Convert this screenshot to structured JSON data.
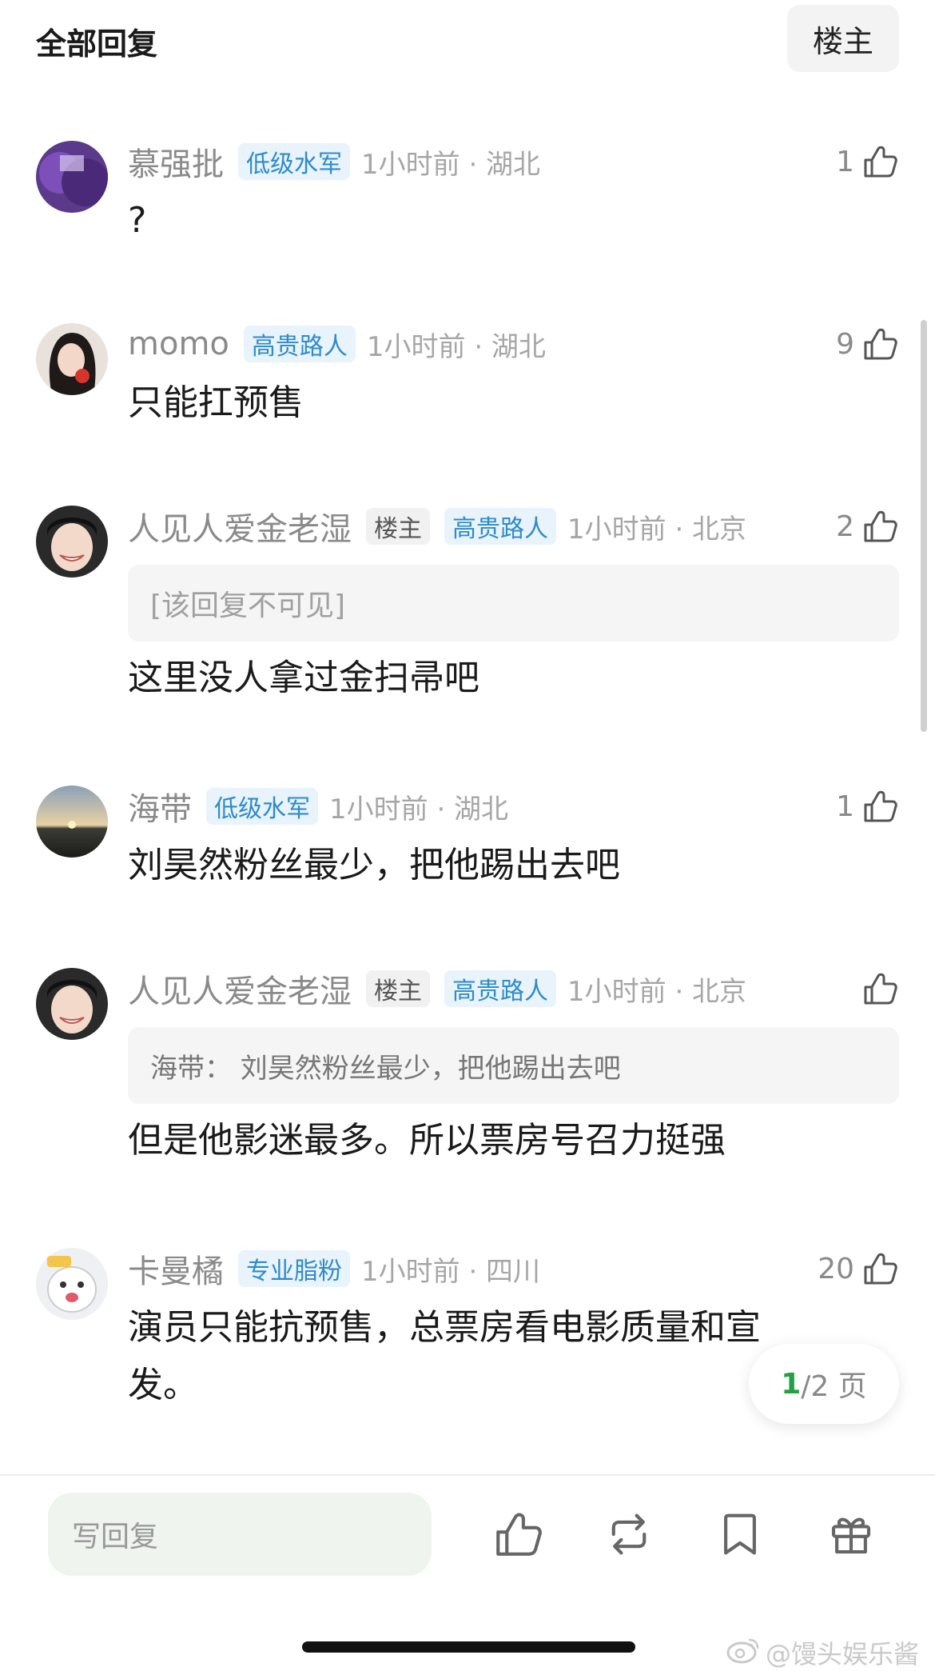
{
  "header": {
    "title": "全部回复",
    "owner_filter": "楼主"
  },
  "comments": [
    {
      "username": "慕强批",
      "badges": [
        "低级水军"
      ],
      "time": "1小时前 · 湖北",
      "likes": "1",
      "text": "?"
    },
    {
      "username": "momo",
      "badges": [
        "高贵路人"
      ],
      "time": "1小时前 · 湖北",
      "likes": "9",
      "text": "只能扛预售"
    },
    {
      "username": "人见人爱金老湿",
      "badges": [
        "楼主",
        "高贵路人"
      ],
      "time": "1小时前 · 北京",
      "likes": "2",
      "quote": "[该回复不可见]",
      "text": "这里没人拿过金扫帚吧"
    },
    {
      "username": "海带",
      "badges": [
        "低级水军"
      ],
      "time": "1小时前 · 湖北",
      "likes": "1",
      "text": "刘昊然粉丝最少，把他踢出去吧"
    },
    {
      "username": "人见人爱金老湿",
      "badges": [
        "楼主",
        "高贵路人"
      ],
      "time": "1小时前 · 北京",
      "likes": "",
      "quote": "海带：  刘昊然粉丝最少，把他踢出去吧",
      "text": "但是他影迷最多。所以票房号召力挺强"
    },
    {
      "username": "卡曼橘",
      "badges": [
        "专业脂粉"
      ],
      "time": "1小时前 · 四川",
      "likes": "20",
      "text_line1": "演员只能抗预售，总票房看电影质量和宣",
      "text_line2": "发。"
    }
  ],
  "pager": {
    "current": "1",
    "total": "/2 页"
  },
  "bottom_bar": {
    "reply_placeholder": "写回复",
    "actions": [
      "like-icon",
      "repost-icon",
      "bookmark-icon",
      "gift-icon"
    ]
  },
  "watermark": "@馒头娱乐酱",
  "colors": {
    "badge_blue": "#2e8bc9",
    "badge_blue_bg": "#e8f3fb",
    "pager_green": "#22a045"
  }
}
